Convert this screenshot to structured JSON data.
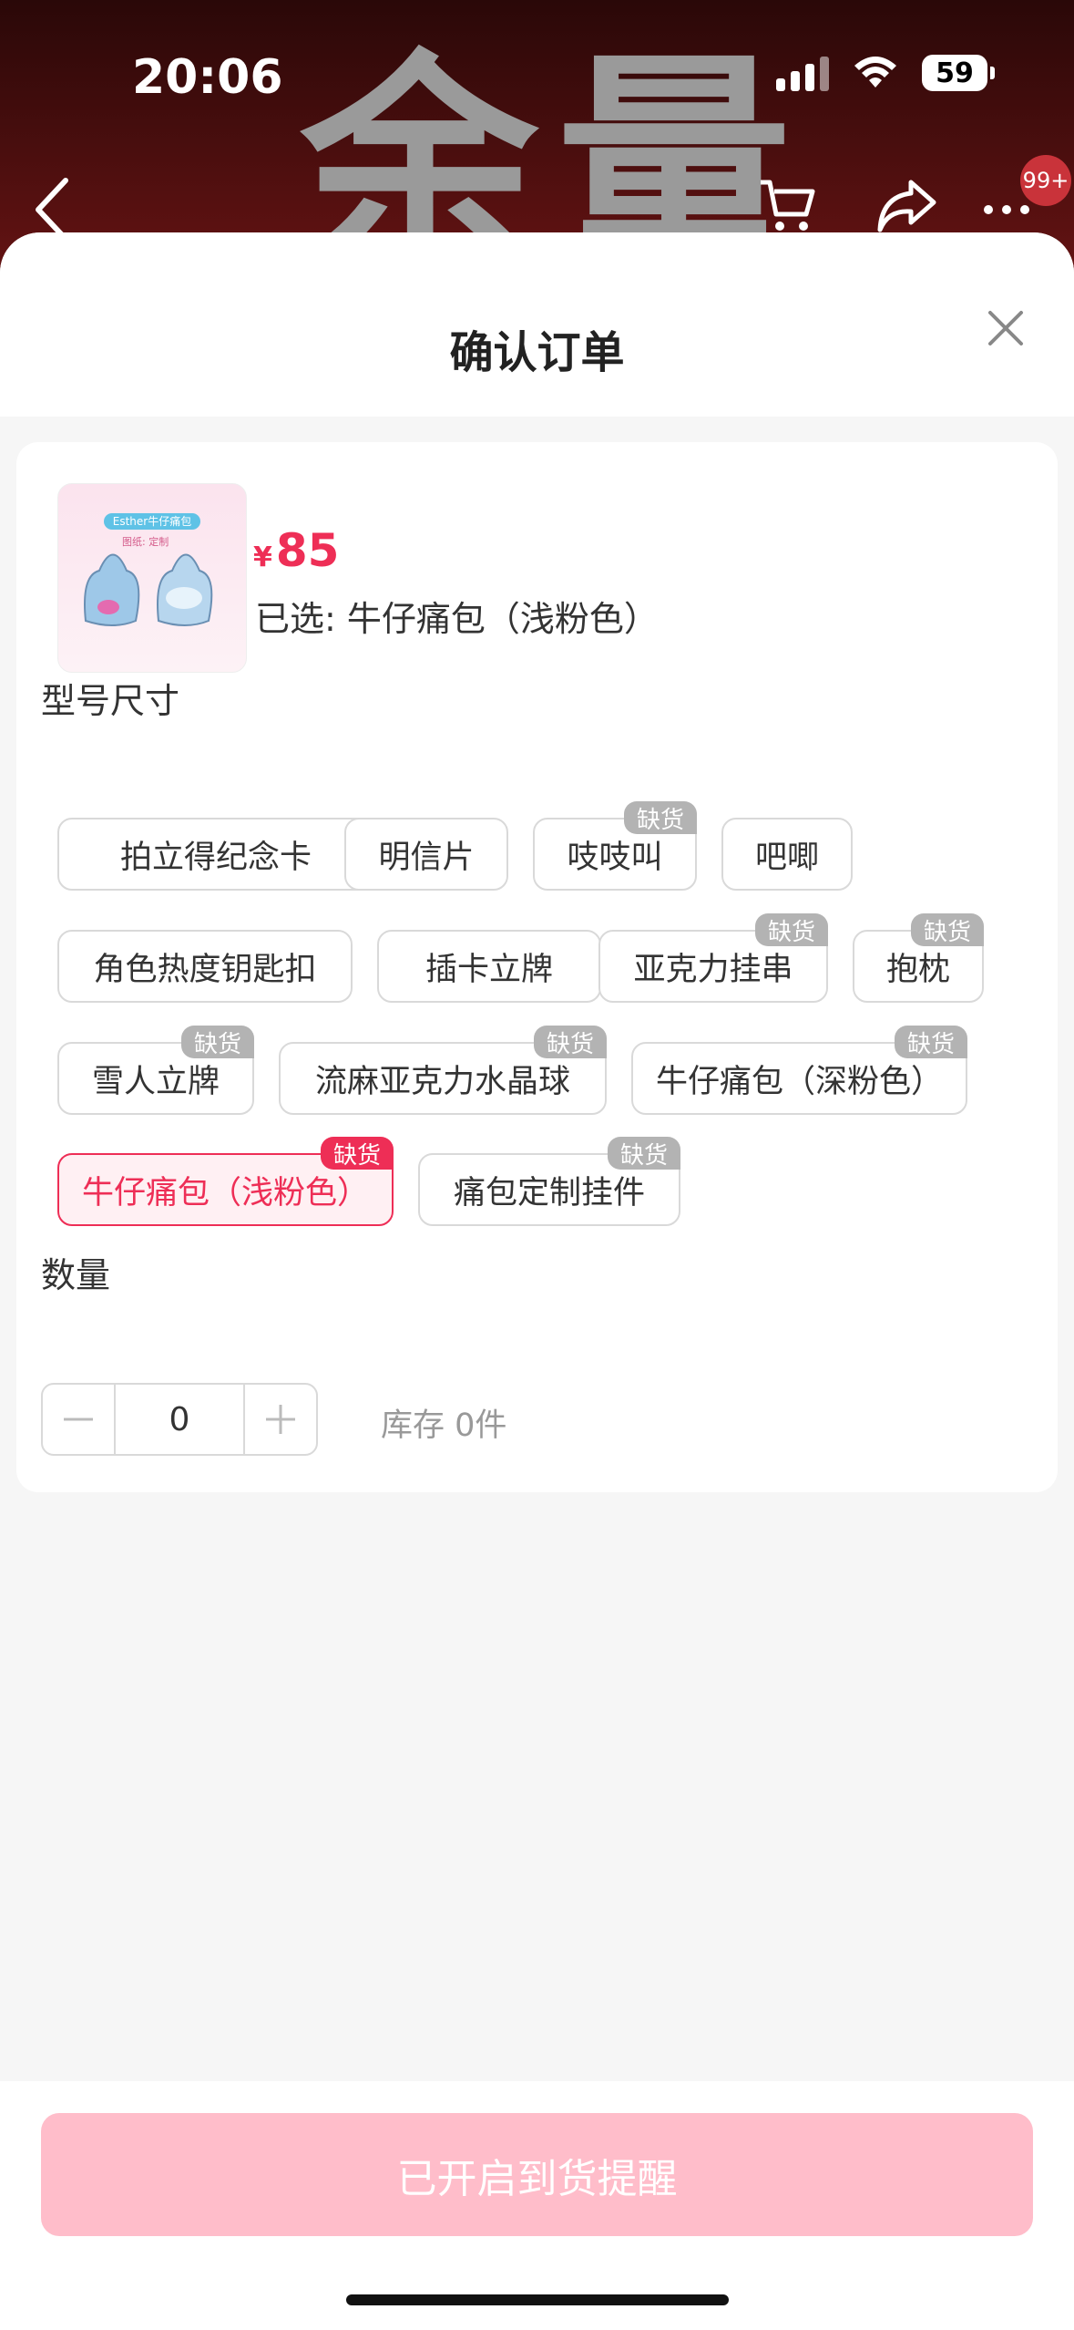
{
  "status_bar": {
    "time": "20:06",
    "battery": "59"
  },
  "background": {
    "glyphs": "余量"
  },
  "nav": {
    "badge": "99+"
  },
  "sheet": {
    "title": "确认订单",
    "product": {
      "thumb_label": "Esther牛仔痛包",
      "thumb_sub": "图纸: 定制",
      "price_symbol": "¥",
      "price": "85",
      "selected_text": "已选: 牛仔痛包（浅粉色）"
    },
    "options_label": "型号尺寸",
    "out_of_stock": "缺货",
    "options": [
      {
        "label": "拍立得纪念卡",
        "tag": false,
        "selected": false
      },
      {
        "label": "明信片",
        "tag": false,
        "selected": false
      },
      {
        "label": "吱吱叫",
        "tag": true,
        "selected": false
      },
      {
        "label": "吧唧",
        "tag": false,
        "selected": false
      },
      {
        "label": "角色热度钥匙扣",
        "tag": false,
        "selected": false
      },
      {
        "label": "插卡立牌",
        "tag": false,
        "selected": false
      },
      {
        "label": "亚克力挂串",
        "tag": true,
        "selected": false
      },
      {
        "label": "抱枕",
        "tag": true,
        "selected": false
      },
      {
        "label": "雪人立牌",
        "tag": true,
        "selected": false
      },
      {
        "label": "流麻亚克力水晶球",
        "tag": true,
        "selected": false
      },
      {
        "label": "牛仔痛包（深粉色）",
        "tag": true,
        "selected": false
      },
      {
        "label": "牛仔痛包（浅粉色）",
        "tag": true,
        "selected": true
      },
      {
        "label": "痛包定制挂件",
        "tag": true,
        "selected": false
      }
    ],
    "quantity_label": "数量",
    "quantity_value": "0",
    "stock_text": "库存 0件"
  },
  "footer": {
    "button_label": "已开启到货提醒"
  },
  "colors": {
    "accent": "#ee2e56",
    "button": "#ffbdca"
  }
}
